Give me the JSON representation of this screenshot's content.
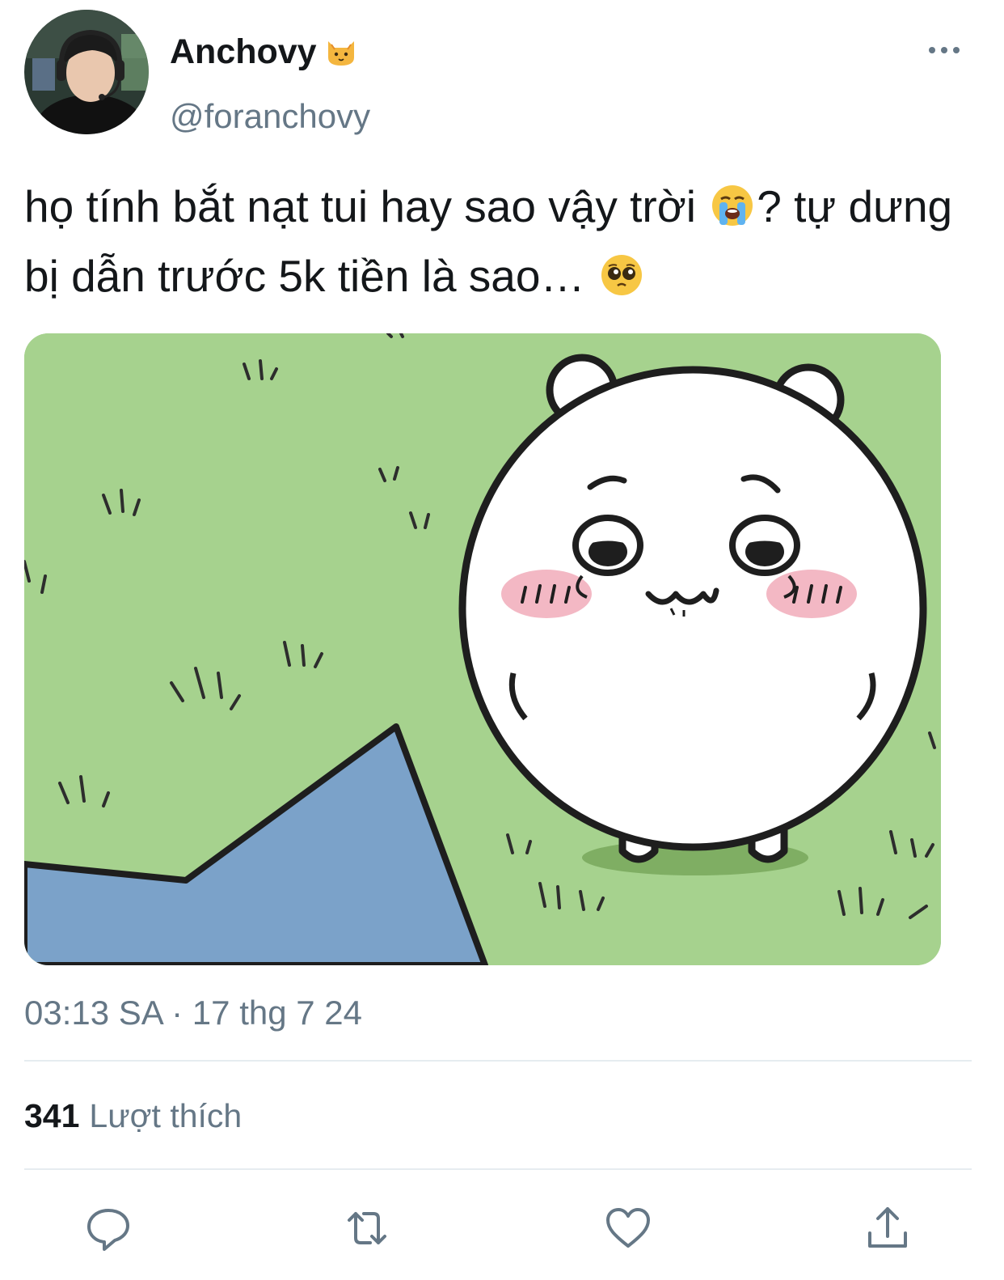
{
  "author": {
    "display_name": "Anchovy",
    "badge_icon": "cat-face-icon",
    "handle": "@foranchovy"
  },
  "tweet": {
    "text_part1": "họ tính bắt nạt tui hay sao vậy trời ",
    "emoji1": "loudly-crying-face-icon",
    "text_part2": "? tự dưng bị dẫn trước 5k tiền là sao… ",
    "emoji2": "pleading-face-icon"
  },
  "media": {
    "description_icon": "crying-hamster-cartoon"
  },
  "meta": {
    "timestamp": "03:13 SA · 17 thg 7 24",
    "likes_count": "341",
    "likes_label": "Lượt thích"
  },
  "actions": [
    "reply-icon",
    "retweet-icon",
    "like-icon",
    "share-icon"
  ],
  "colors": {
    "text_primary": "#14171a",
    "text_secondary": "#657786",
    "divider": "#e6ecf0",
    "grass": "#a6d28e",
    "pond": "#7ba2c9"
  }
}
